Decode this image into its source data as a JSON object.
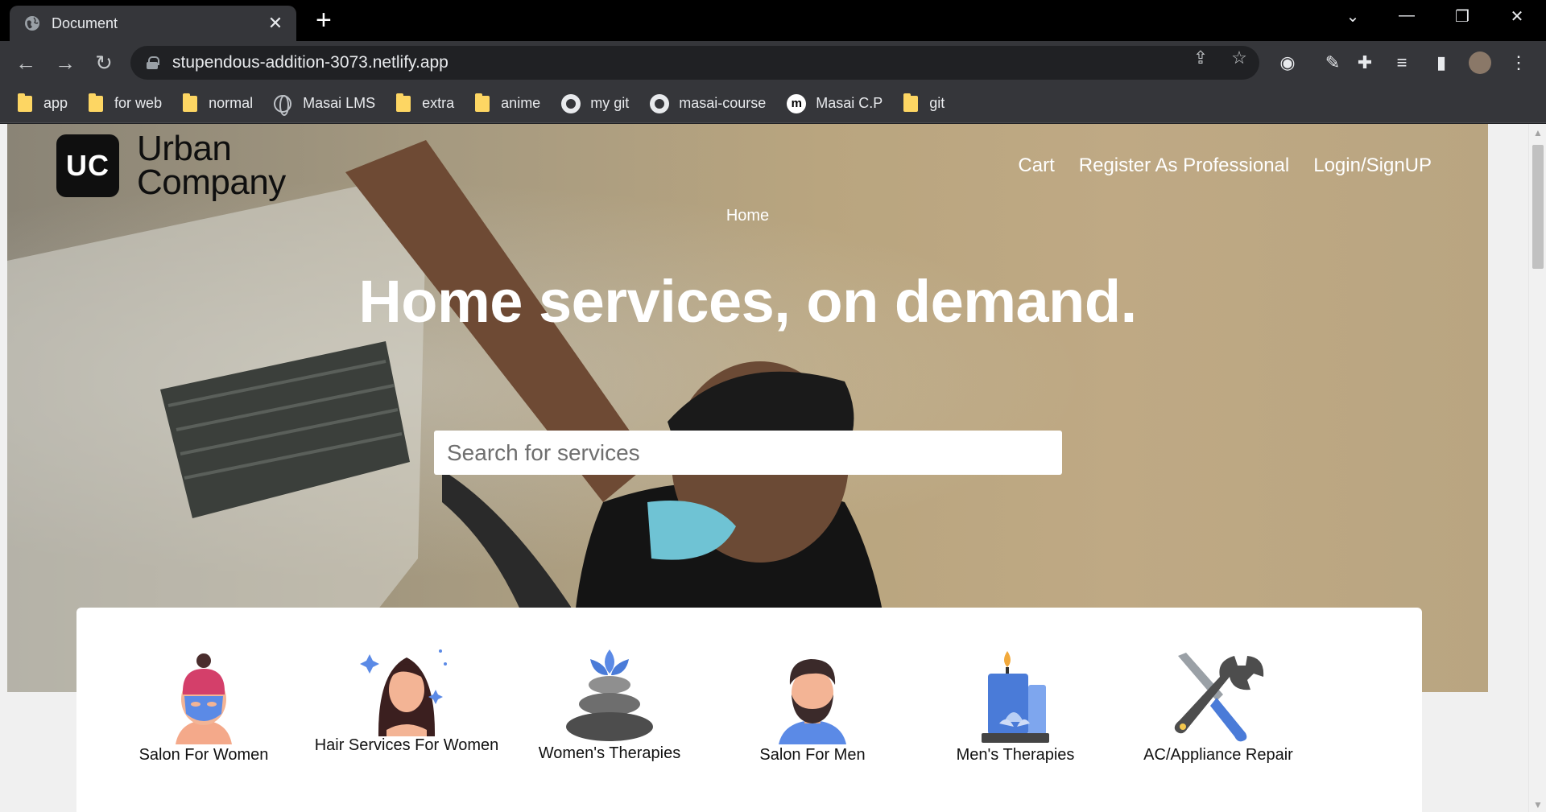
{
  "browser": {
    "tab_title": "Document",
    "url": "stupendous-addition-3073.netlify.app",
    "bookmarks": [
      {
        "label": "app",
        "icon": "folder-icon"
      },
      {
        "label": "for web",
        "icon": "folder-icon"
      },
      {
        "label": "normal",
        "icon": "folder-icon"
      },
      {
        "label": "Masai LMS",
        "icon": "globe-icon"
      },
      {
        "label": "extra",
        "icon": "folder-icon"
      },
      {
        "label": "anime",
        "icon": "folder-icon"
      },
      {
        "label": "my git",
        "icon": "github-icon"
      },
      {
        "label": "masai-course",
        "icon": "github-icon"
      },
      {
        "label": "Masai C.P",
        "icon": "masai-icon"
      },
      {
        "label": "git",
        "icon": "folder-icon"
      }
    ]
  },
  "page": {
    "logo": {
      "mark": "UC",
      "line1": "Urban",
      "line2": "Company"
    },
    "nav": {
      "cart": "Cart",
      "register": "Register As Professional",
      "login": "Login/SignUP"
    },
    "home_link": "Home",
    "headline": "Home services, on demand.",
    "search": {
      "placeholder": "Search for services",
      "value": ""
    },
    "services": [
      {
        "label": "Salon For Women"
      },
      {
        "label": "Hair Services For Women"
      },
      {
        "label": "Women's Therapies"
      },
      {
        "label": "Salon For Men"
      },
      {
        "label": "Men's Therapies"
      },
      {
        "label": "AC/Appliance Repair"
      }
    ]
  },
  "colors": {
    "brand_dark": "#0f0f0f",
    "hero_tone": "#b9a57f",
    "accent_blue": "#4a86e8"
  }
}
